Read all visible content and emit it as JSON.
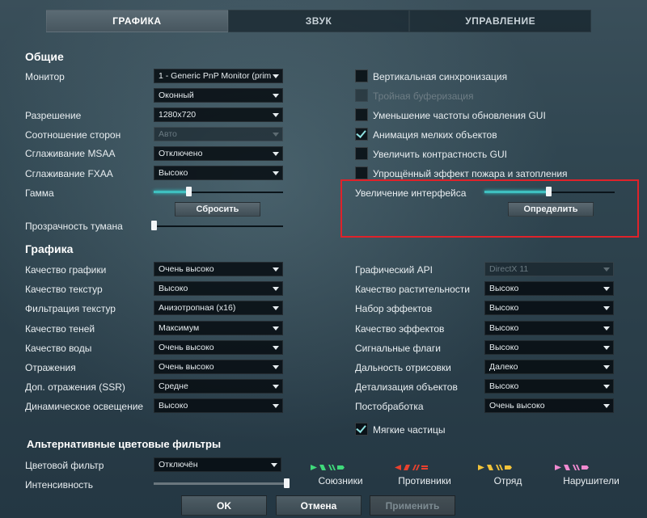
{
  "tabs": [
    {
      "label": "ГРАФИКА",
      "active": true
    },
    {
      "label": "ЗВУК",
      "active": false
    },
    {
      "label": "УПРАВЛЕНИЕ",
      "active": false
    }
  ],
  "general": {
    "title": "Общие",
    "monitor": {
      "label": "Монитор",
      "value": "1 - Generic PnP Monitor (prim"
    },
    "window_mode": {
      "value": "Оконный"
    },
    "resolution": {
      "label": "Разрешение",
      "value": "1280x720"
    },
    "aspect": {
      "label": "Соотношение сторон",
      "value": "Авто"
    },
    "msaa": {
      "label": "Сглаживание MSAA",
      "value": "Отключено"
    },
    "fxaa": {
      "label": "Сглаживание FXAA",
      "value": "Высоко"
    },
    "gamma": {
      "label": "Гамма",
      "level_percent": 27,
      "reset_label": "Сбросить"
    },
    "fog": {
      "label": "Прозрачность тумана",
      "level_percent": 0
    },
    "checkboxes": [
      {
        "label": "Вертикальная синхронизация",
        "checked": false,
        "disabled": false
      },
      {
        "label": "Тройная буферизация",
        "checked": false,
        "disabled": true
      },
      {
        "label": "Уменьшение частоты обновления GUI",
        "checked": false,
        "disabled": false
      },
      {
        "label": "Анимация мелких объектов",
        "checked": true,
        "disabled": false
      },
      {
        "label": "Увеличить контрастность GUI",
        "checked": false,
        "disabled": false
      },
      {
        "label": "Упрощённый эффект пожара и затопления",
        "checked": false,
        "disabled": false
      }
    ],
    "ui_scale": {
      "label": "Увеличение интерфейса",
      "level_percent": 49,
      "detect_label": "Определить"
    }
  },
  "graphics": {
    "title": "Графика",
    "left": [
      {
        "label": "Качество графики",
        "value": "Очень высоко"
      },
      {
        "label": "Качество текстур",
        "value": "Высоко"
      },
      {
        "label": "Фильтрация текстур",
        "value": "Анизотропная (x16)"
      },
      {
        "label": "Качество теней",
        "value": "Максимум"
      },
      {
        "label": "Качество воды",
        "value": "Очень высоко"
      },
      {
        "label": "Отражения",
        "value": "Очень высоко"
      },
      {
        "label": "Доп. отражения (SSR)",
        "value": "Средне"
      },
      {
        "label": "Динамическое освещение",
        "value": "Высоко"
      }
    ],
    "right": [
      {
        "label": "Графический API",
        "value": "DirectX 11",
        "disabled": true
      },
      {
        "label": "Качество растительности",
        "value": "Высоко"
      },
      {
        "label": "Набор эффектов",
        "value": "Высоко"
      },
      {
        "label": "Качество эффектов",
        "value": "Высоко"
      },
      {
        "label": "Сигнальные флаги",
        "value": "Высоко"
      },
      {
        "label": "Дальность отрисовки",
        "value": "Далеко"
      },
      {
        "label": "Детализация объектов",
        "value": "Высоко"
      },
      {
        "label": "Постобработка",
        "value": "Очень высоко"
      }
    ],
    "soft_particles": {
      "label": "Мягкие частицы",
      "checked": true
    }
  },
  "color_filters": {
    "title": "Альтернативные цветовые фильтры",
    "filter": {
      "label": "Цветовой фильтр",
      "value": "Отключён"
    },
    "intensity": {
      "label": "Интенсивность",
      "level_percent": 100
    },
    "teams": [
      {
        "label": "Союзники",
        "color": "#3fd97a"
      },
      {
        "label": "Противники",
        "color": "#e8412e"
      },
      {
        "label": "Отряд",
        "color": "#f2c33a"
      },
      {
        "label": "Нарушители",
        "color": "#f08ad0"
      }
    ]
  },
  "footer": {
    "ok": "OK",
    "cancel": "Отмена",
    "apply": "Применить"
  }
}
